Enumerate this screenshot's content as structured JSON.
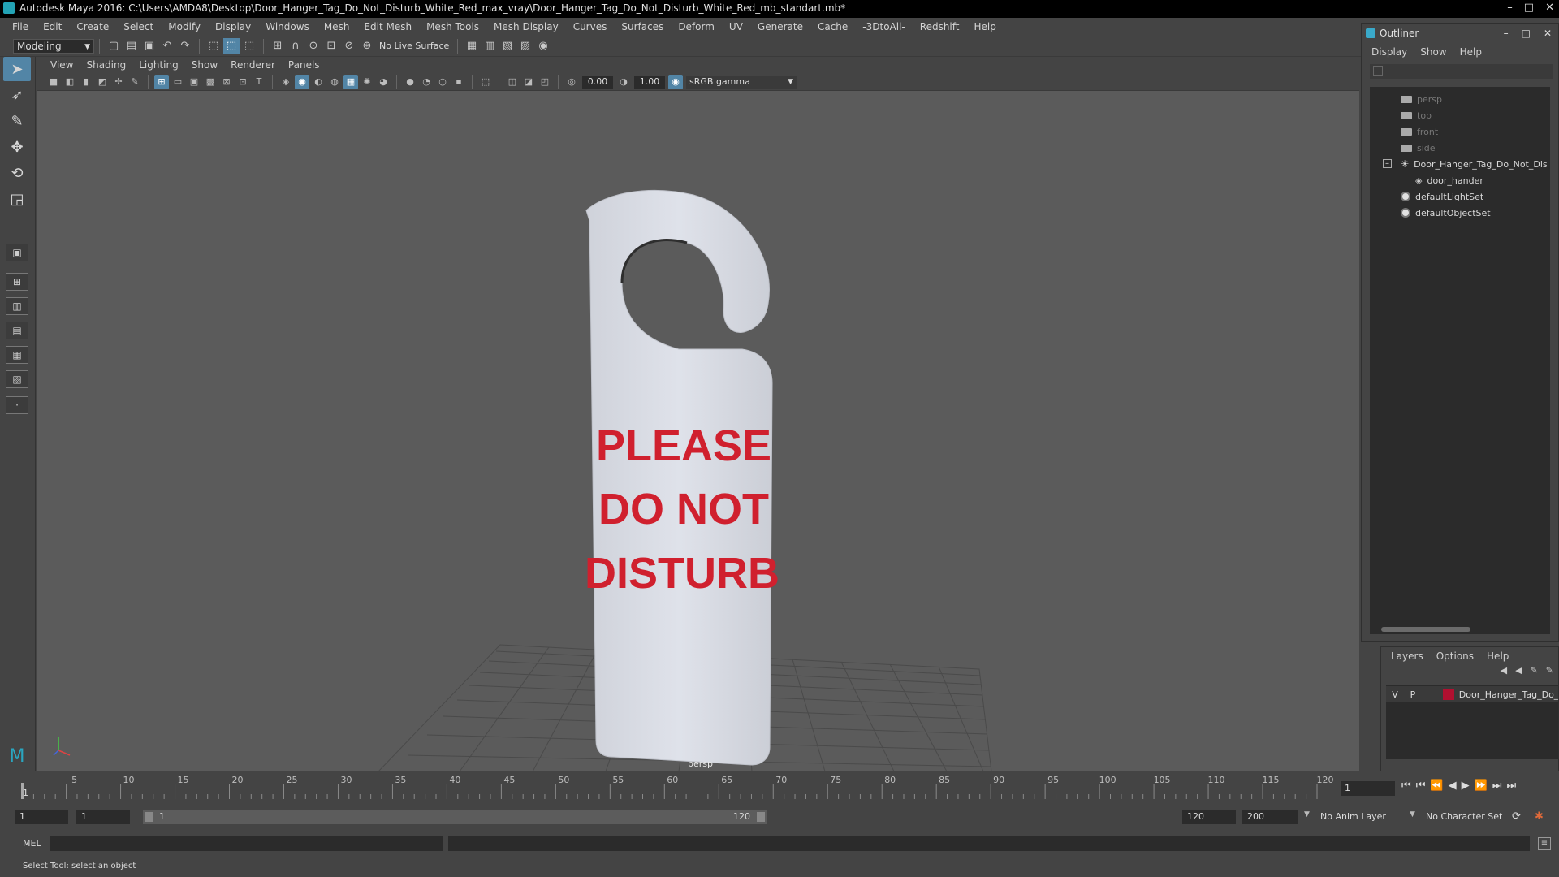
{
  "window": {
    "title": "Autodesk Maya 2016: C:\\Users\\AMDA8\\Desktop\\Door_Hanger_Tag_Do_Not_Disturb_White_Red_max_vray\\Door_Hanger_Tag_Do_Not_Disturb_White_Red_mb_standart.mb*",
    "controls": [
      "–",
      "□",
      "✕"
    ]
  },
  "menubar": [
    "File",
    "Edit",
    "Create",
    "Select",
    "Modify",
    "Display",
    "Windows",
    "Mesh",
    "Edit Mesh",
    "Mesh Tools",
    "Mesh Display",
    "Curves",
    "Surfaces",
    "Deform",
    "UV",
    "Generate",
    "Cache",
    "-3DtoAll-",
    "Redshift",
    "Help"
  ],
  "statusline": {
    "mode": "Modeling",
    "live_surface": "No Live Surface"
  },
  "panel": {
    "menu": [
      "View",
      "Shading",
      "Lighting",
      "Show",
      "Renderer",
      "Panels"
    ],
    "exposure": "0.00",
    "gamma": "1.00",
    "color_space": "sRGB gamma",
    "camera_label": "persp"
  },
  "model": {
    "sign_line1": "PLEASE",
    "sign_line2": "DO NOT",
    "sign_line3": "DISTURB",
    "sign_text_color": "#d0202e",
    "tag_color": "#d8dbe3"
  },
  "outliner": {
    "title": "Outliner",
    "menu": [
      "Display",
      "Show",
      "Help"
    ],
    "items": [
      {
        "label": "persp"
      },
      {
        "label": "top"
      },
      {
        "label": "front"
      },
      {
        "label": "side"
      },
      {
        "label": "Door_Hanger_Tag_Do_Not_Dis"
      },
      {
        "label": "door_hander"
      },
      {
        "label": "defaultLightSet"
      },
      {
        "label": "defaultObjectSet"
      }
    ]
  },
  "layers": {
    "menu": [
      "Layers",
      "Options",
      "Help"
    ],
    "layer": {
      "v": "V",
      "p": "P",
      "name": "Door_Hanger_Tag_Do_",
      "color": "#b01030"
    }
  },
  "timeline": {
    "ticks": [
      "1",
      "5",
      "10",
      "15",
      "20",
      "25",
      "30",
      "35",
      "40",
      "45",
      "50",
      "55",
      "60",
      "65",
      "70",
      "75",
      "80",
      "85",
      "90",
      "95",
      "100",
      "105",
      "110",
      "115",
      "120"
    ],
    "current_frame": "1"
  },
  "range": {
    "start": "1",
    "start2": "1",
    "slider_start": "1",
    "slider_end": "120",
    "end": "120",
    "end2": "200",
    "anim_layer": "No Anim Layer",
    "character_set": "No Character Set"
  },
  "cmdline": {
    "label": "MEL"
  },
  "helpline": {
    "message": "Select Tool: select an object"
  }
}
